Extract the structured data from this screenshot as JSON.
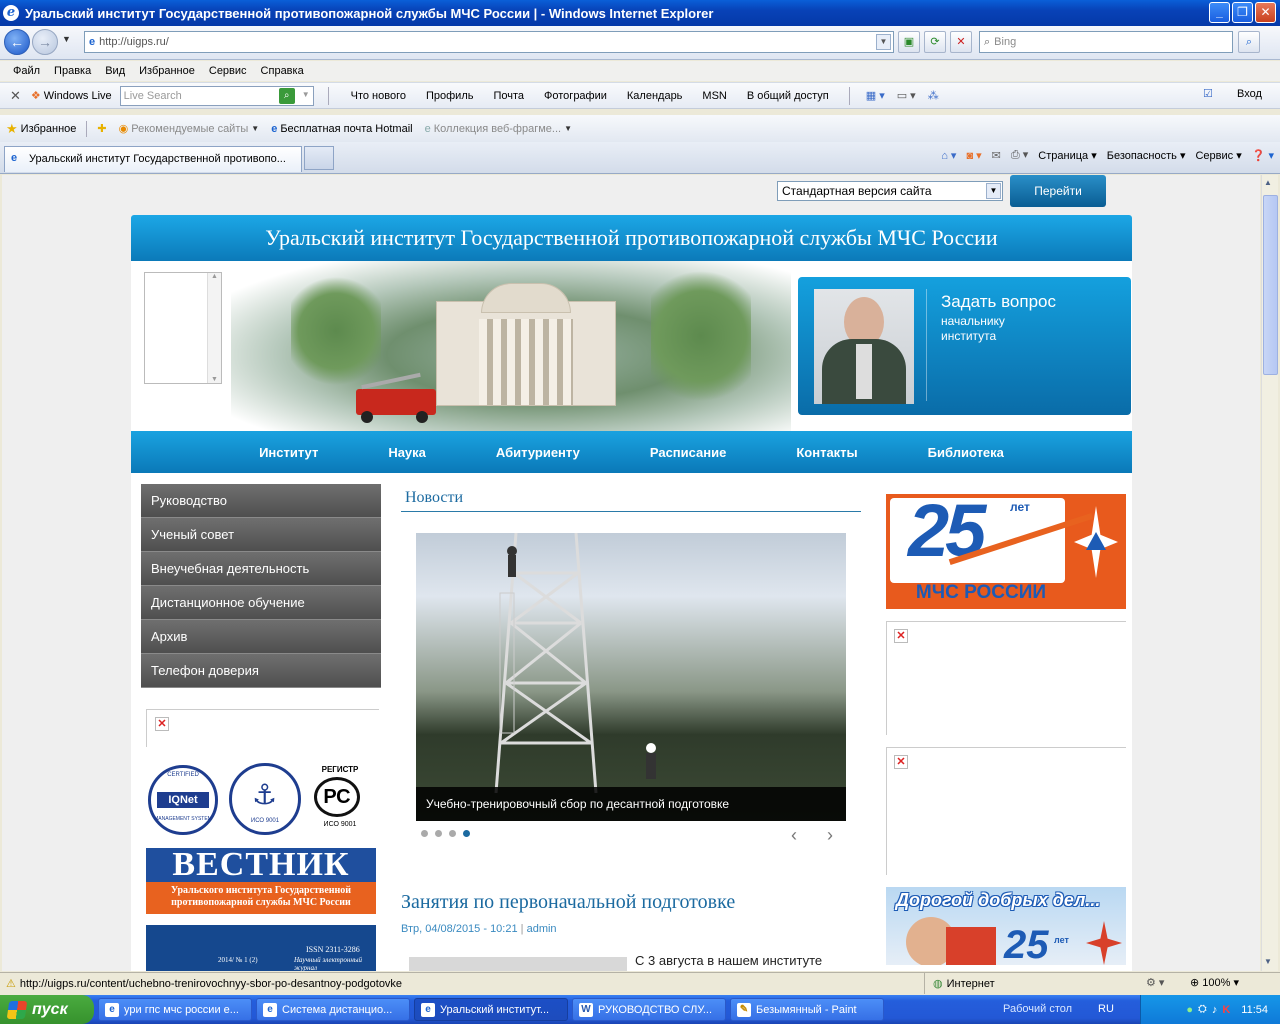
{
  "window": {
    "title": "Уральский институт Государственной противопожарной службы МЧС России | - Windows Internet Explorer"
  },
  "address": {
    "url": "http://uigps.ru/",
    "search_placeholder": "Bing"
  },
  "menu": [
    "Файл",
    "Правка",
    "Вид",
    "Избранное",
    "Сервис",
    "Справка"
  ],
  "live_toolbar": {
    "brand": "Windows Live",
    "search_placeholder": "Live Search",
    "links": [
      "Что нового",
      "Профиль",
      "Почта",
      "Фотографии",
      "Календарь",
      "MSN",
      "В общий доступ"
    ],
    "signin": "Вход"
  },
  "favorites": {
    "label": "Избранное",
    "items": [
      "Рекомендуемые сайты",
      "Бесплатная почта Hotmail",
      "Коллекция веб-фрагме..."
    ]
  },
  "tab": {
    "title": "Уральский институт Государственной противопо..."
  },
  "commands": [
    "Страница",
    "Безопасность",
    "Сервис"
  ],
  "site": {
    "version_select": "Стандартная версия сайта",
    "go_button": "Перейти",
    "header_title": "Уральский институт Государственной противопожарной службы МЧС России",
    "ask": {
      "title": "Задать вопрос",
      "subtitle": "начальнику института"
    },
    "nav": [
      "Институт",
      "Наука",
      "Абитуриенту",
      "Расписание",
      "Контакты",
      "Библиотека"
    ],
    "side_menu": [
      "Руководство",
      "Ученый совет",
      "Внеучебная деятельность",
      "Дистанционное обучение",
      "Архив",
      "Телефон доверия"
    ],
    "logos": {
      "iqnet": "IQNet",
      "iqnet_top": "CERTIFIED",
      "iqnet_bottom": "MANAGEMENT SYSTEM",
      "iso": "ИСО 9001",
      "register": "РЕГИСТР",
      "register_iso": "ИСО 9001"
    },
    "vestnik": {
      "title": "ВЕСТНИК",
      "subtitle": "Уральского института Государственной противопожарной службы МЧС России",
      "issn": "ISSN 2311-3286",
      "issue": "2014/ № 1 (2)",
      "journal": "Научный электронный журнал"
    },
    "news_heading": "Новости",
    "slide_caption": "Учебно-тренировочный сбор по десантной подготовке",
    "slider_prev": "‹",
    "slider_next": "›",
    "article": {
      "title": "Занятия по первоначальной подготовке",
      "date": "Втр, 04/08/2015 - 10:21",
      "author": "admin",
      "text": "С 3 августа в нашем институте"
    },
    "ad25": {
      "number": "25",
      "years": "лет",
      "org": "МЧС РОССИИ"
    },
    "ad_kind": {
      "text": "Дорогой добрых дел...",
      "number": "25",
      "years": "лет"
    }
  },
  "status": {
    "url": "http://uigps.ru/content/uchebno-trenirovochnyy-sbor-po-desantnoy-podgotovke",
    "zone": "Интернет",
    "zoom": "100%"
  },
  "taskbar": {
    "start": "пуск",
    "tasks": [
      "ури гпс мчс россии е...",
      "Система дистанцио...",
      "Уральский институт...",
      "РУКОВОДСТВО СЛУ...",
      "Безымянный - Paint"
    ],
    "desktop": "Рабочий стол",
    "lang": "RU",
    "time": "11:54"
  }
}
